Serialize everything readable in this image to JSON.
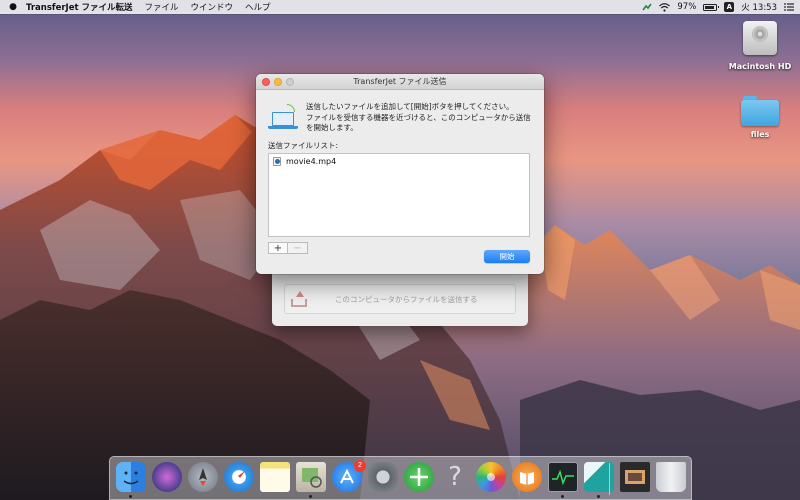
{
  "menubar": {
    "app_name": "TransferJet ファイル転送",
    "menus": [
      "ファイル",
      "ウインドウ",
      "ヘルプ"
    ],
    "battery": "97%",
    "input_source": "A",
    "clock": "火 13:53"
  },
  "desktop": {
    "icons": [
      {
        "label": "Macintosh HD"
      },
      {
        "label": "files"
      }
    ]
  },
  "window": {
    "title": "TransferJet ファイル送信",
    "instruction_lines": [
      "送信したいファイルを追加して[開始]ボタを押してください。",
      "ファイルを受信する機器を近づけると、このコンピュータから送信",
      "を開始します。"
    ],
    "list_label": "送信ファイルリスト:",
    "files": [
      "movie4.mp4"
    ],
    "add_label": "+",
    "remove_label": "−",
    "start_label": "開始"
  },
  "back_window": {
    "send_button_label": "このコンピュータからファイルを送信する"
  },
  "dock": {
    "apps": [
      {
        "name": "finder",
        "color": "#3a8df0"
      },
      {
        "name": "siri",
        "color": "#4b3e8f"
      },
      {
        "name": "launchpad",
        "color": "#8a8f98"
      },
      {
        "name": "safari",
        "color": "#2f8fe0"
      },
      {
        "name": "notes",
        "color": "#f5e279"
      },
      {
        "name": "preview",
        "color": "#d9d3c4"
      },
      {
        "name": "app-store",
        "color": "#1d8df0",
        "badge": "2"
      },
      {
        "name": "system-preferences",
        "color": "#7b7f86"
      },
      {
        "name": "migration",
        "color": "#35b34a"
      },
      {
        "name": "help",
        "color": "#c4c7cc"
      },
      {
        "name": "photos",
        "color": "#f2f2f2"
      },
      {
        "name": "ibooks",
        "color": "#f18f2a"
      },
      {
        "name": "activity-monitor",
        "color": "#2a2f33"
      },
      {
        "name": "transferjet",
        "color": "#1fa3a0"
      },
      {
        "name": "photo-browser",
        "color": "#2a2a2a"
      },
      {
        "name": "trash",
        "color": "#d8dade"
      }
    ]
  }
}
